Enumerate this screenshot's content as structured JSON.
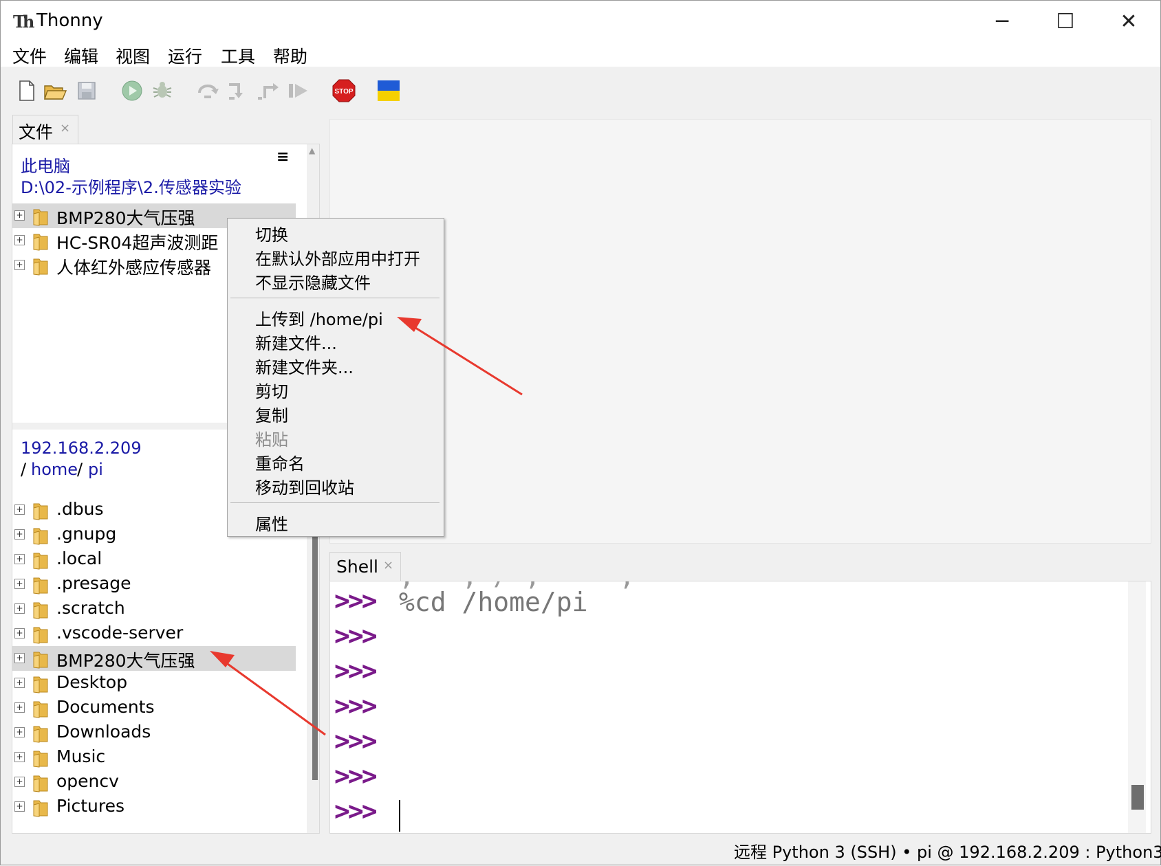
{
  "window": {
    "title": "Thonny",
    "app_icon": "Th",
    "controls": {
      "minimize": "─",
      "maximize": "☐",
      "close": "✕"
    }
  },
  "menubar": [
    "文件",
    "编辑",
    "视图",
    "运行",
    "工具",
    "帮助"
  ],
  "toolbar": {
    "icons": [
      "new-file-icon",
      "open-file-icon",
      "save-icon",
      "run-icon",
      "debug-icon",
      "step-over-icon",
      "step-into-icon",
      "step-out-icon",
      "resume-icon",
      "stop-icon",
      "ukraine-flag-icon"
    ],
    "stop_label": "STOP"
  },
  "files_pane": {
    "tab_label": "文件",
    "tab_close": "×",
    "local": {
      "location": "此电脑",
      "path": "D:\\02-示例程序\\2.传感器实验",
      "items": [
        "BMP280大气压强",
        "HC-SR04超声波测距",
        "人体红外感应传感器"
      ]
    },
    "remote": {
      "host": "192.168.2.209",
      "path_sep": "/",
      "path_home": "home",
      "path_pi": "pi",
      "items": [
        ".dbus",
        ".gnupg",
        ".local",
        ".presage",
        ".scratch",
        ".vscode-server",
        "BMP280大气压强",
        "Desktop",
        "Documents",
        "Downloads",
        "Music",
        "opencv",
        "Pictures"
      ]
    },
    "menu_icon": "≡"
  },
  "context_menu": {
    "group1": [
      "切换",
      "在默认外部应用中打开",
      "不显示隐藏文件"
    ],
    "group2": [
      "上传到 /home/pi",
      "新建文件...",
      "新建文件夹...",
      "剪切",
      "复制",
      "粘贴",
      "重命名",
      "移动到回收站"
    ],
    "group3": [
      "属性"
    ],
    "disabled": [
      "粘贴"
    ]
  },
  "shell": {
    "tab_label": "Shell",
    "tab_close": "×",
    "prompt": ">>>",
    "first_command": "%cd /home/pi"
  },
  "statusbar": {
    "text": "远程 Python 3 (SSH)  •  pi @ 192.168.2.209 : Python3"
  },
  "colors": {
    "prompt": "#7a1a8a",
    "link": "#1a1aa6",
    "annotation_arrow": "#e8392e"
  }
}
